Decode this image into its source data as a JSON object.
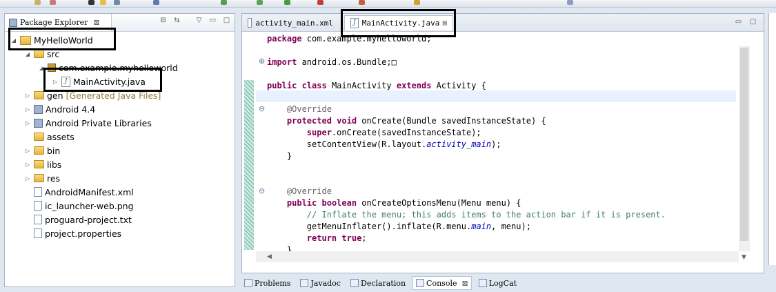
{
  "package_explorer": {
    "tab_label": "Package Explorer",
    "tree": [
      {
        "label": "MyHelloWorld",
        "level": 0,
        "twisty": "◢",
        "icon": "project-icon"
      },
      {
        "label": "src",
        "level": 1,
        "twisty": "◢",
        "icon": "source-folder-icon"
      },
      {
        "label": "com.example.myhelloworld",
        "level": 2,
        "twisty": "◢",
        "icon": "package-icon"
      },
      {
        "label": "MainActivity.java",
        "level": 3,
        "twisty": "▷",
        "icon": "java-file-icon"
      },
      {
        "label": "gen",
        "sub": "[Generated Java Files]",
        "level": 1,
        "twisty": "▷",
        "icon": "source-folder-icon"
      },
      {
        "label": "Android 4.4",
        "level": 1,
        "twisty": "▷",
        "icon": "library-icon"
      },
      {
        "label": "Android Private Libraries",
        "level": 1,
        "twisty": "▷",
        "icon": "library-icon"
      },
      {
        "label": "assets",
        "level": 1,
        "twisty": "",
        "icon": "folder-icon"
      },
      {
        "label": "bin",
        "level": 1,
        "twisty": "▷",
        "icon": "folder-icon"
      },
      {
        "label": "libs",
        "level": 1,
        "twisty": "▷",
        "icon": "folder-icon"
      },
      {
        "label": "res",
        "level": 1,
        "twisty": "▷",
        "icon": "folder-icon"
      },
      {
        "label": "AndroidManifest.xml",
        "level": 1,
        "twisty": "",
        "icon": "xml-file-icon"
      },
      {
        "label": "ic_launcher-web.png",
        "level": 1,
        "twisty": "",
        "icon": "image-file-icon"
      },
      {
        "label": "proguard-project.txt",
        "level": 1,
        "twisty": "",
        "icon": "text-file-icon"
      },
      {
        "label": "project.properties",
        "level": 1,
        "twisty": "",
        "icon": "text-file-icon"
      }
    ]
  },
  "editor": {
    "tabs": [
      {
        "label": "activity_main.xml",
        "active": false
      },
      {
        "label": "MainActivity.java",
        "active": true
      }
    ],
    "lines": [
      {
        "parts": [
          [
            "kw",
            "package"
          ],
          [
            "plain",
            " com.example.myhelloworld;"
          ]
        ]
      },
      {
        "parts": []
      },
      {
        "parts": [
          [
            "kw",
            "import"
          ],
          [
            "plain",
            " android.os.Bundle;□"
          ]
        ]
      },
      {
        "parts": []
      },
      {
        "parts": [
          [
            "kw",
            "public"
          ],
          [
            "plain",
            " "
          ],
          [
            "kw",
            "class"
          ],
          [
            "plain",
            " MainActivity "
          ],
          [
            "kw",
            "extends"
          ],
          [
            "plain",
            " Activity {"
          ]
        ]
      },
      {
        "parts": []
      },
      {
        "parts": [
          [
            "ann",
            "    @Override"
          ]
        ]
      },
      {
        "parts": [
          [
            "plain",
            "    "
          ],
          [
            "kw",
            "protected"
          ],
          [
            "plain",
            " "
          ],
          [
            "kw",
            "void"
          ],
          [
            "plain",
            " onCreate(Bundle savedInstanceState) {"
          ]
        ]
      },
      {
        "parts": [
          [
            "plain",
            "        "
          ],
          [
            "kw",
            "super"
          ],
          [
            "plain",
            ".onCreate(savedInstanceState);"
          ]
        ]
      },
      {
        "parts": [
          [
            "plain",
            "        setContentView(R.layout."
          ],
          [
            "fld",
            "activity_main"
          ],
          [
            "plain",
            ");"
          ]
        ]
      },
      {
        "parts": [
          [
            "plain",
            "    }"
          ]
        ]
      },
      {
        "parts": []
      },
      {
        "parts": []
      },
      {
        "parts": [
          [
            "ann",
            "    @Override"
          ]
        ]
      },
      {
        "parts": [
          [
            "plain",
            "    "
          ],
          [
            "kw",
            "public"
          ],
          [
            "plain",
            " "
          ],
          [
            "kw",
            "boolean"
          ],
          [
            "plain",
            " onCreateOptionsMenu(Menu menu) {"
          ]
        ]
      },
      {
        "parts": [
          [
            "cmt",
            "        // Inflate the menu; this adds items to the action bar if it is present."
          ]
        ]
      },
      {
        "parts": [
          [
            "plain",
            "        getMenuInflater().inflate(R.menu."
          ],
          [
            "fld",
            "main"
          ],
          [
            "plain",
            ", menu);"
          ]
        ]
      },
      {
        "parts": [
          [
            "plain",
            "        "
          ],
          [
            "kw",
            "return"
          ],
          [
            "plain",
            " "
          ],
          [
            "kw",
            "true"
          ],
          [
            "plain",
            ";"
          ]
        ]
      },
      {
        "parts": [
          [
            "plain",
            "    }"
          ]
        ]
      }
    ]
  },
  "bottom_tabs": [
    {
      "label": "Problems",
      "icon": "problems-icon",
      "active": false
    },
    {
      "label": "Javadoc",
      "icon": "javadoc-icon",
      "active": false
    },
    {
      "label": "Declaration",
      "icon": "declaration-icon",
      "active": false
    },
    {
      "label": "Console",
      "icon": "console-icon",
      "active": true
    },
    {
      "label": "LogCat",
      "icon": "logcat-icon",
      "active": false
    }
  ]
}
